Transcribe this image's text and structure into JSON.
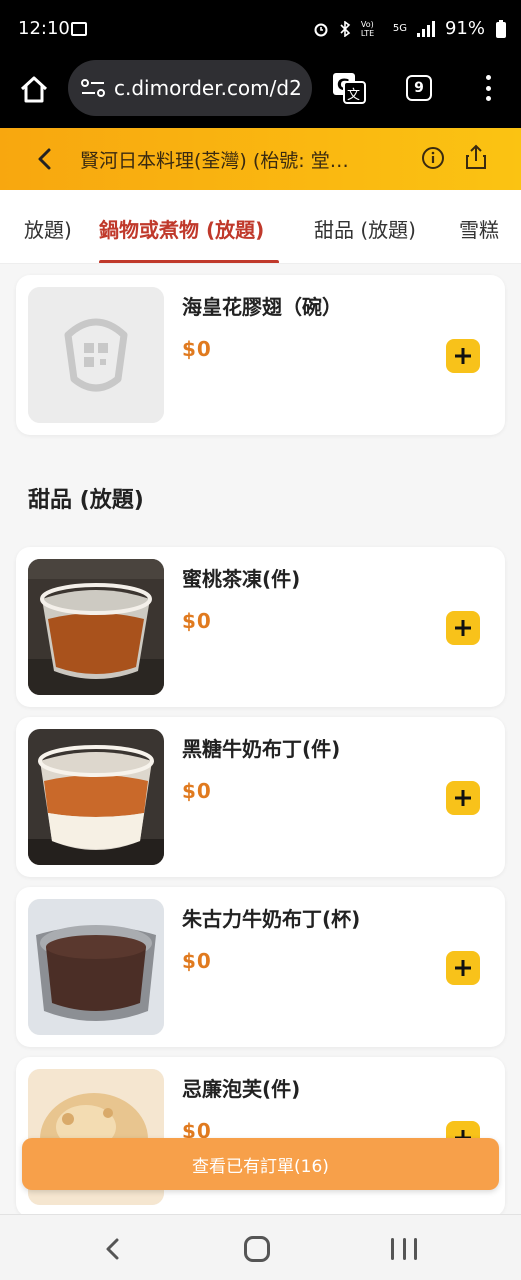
{
  "status_bar": {
    "time": "12:10",
    "network": "5G",
    "lte": "Vo) LTE",
    "battery": "91%"
  },
  "browser": {
    "url": "c.dimorder.com/d2",
    "tabs_count": "9"
  },
  "header": {
    "title": "賢河日本料理(荃灣) (枱號: 堂…"
  },
  "category_tabs": [
    {
      "label": "放題)"
    },
    {
      "label": "鍋物或煮物 (放題)",
      "active": true
    },
    {
      "label": "甜品 (放題)"
    },
    {
      "label": "雪糕"
    }
  ],
  "items_top": [
    {
      "name": "海皇花膠翅（碗）",
      "price": "$0",
      "image": "placeholder-logo"
    }
  ],
  "section": {
    "title": "甜品 (放題)"
  },
  "items": [
    {
      "name": "蜜桃茶凍(件)",
      "price": "$0",
      "image": "peach-tea-jelly"
    },
    {
      "name": "黑糖牛奶布丁(件)",
      "price": "$0",
      "image": "brown-sugar-pudding"
    },
    {
      "name": "朱古力牛奶布丁(杯)",
      "price": "$0",
      "image": "chocolate-pudding"
    },
    {
      "name": "忌廉泡芙(件)",
      "price": "$0",
      "image": "cream-puff"
    }
  ],
  "order_button": {
    "label": "查看已有訂單(16)"
  },
  "colors": {
    "accent": "#f8c21a",
    "header": "#fbb812",
    "active_tab": "#c0392b",
    "price": "#e07a1f",
    "order_button": "#f7a04a"
  }
}
